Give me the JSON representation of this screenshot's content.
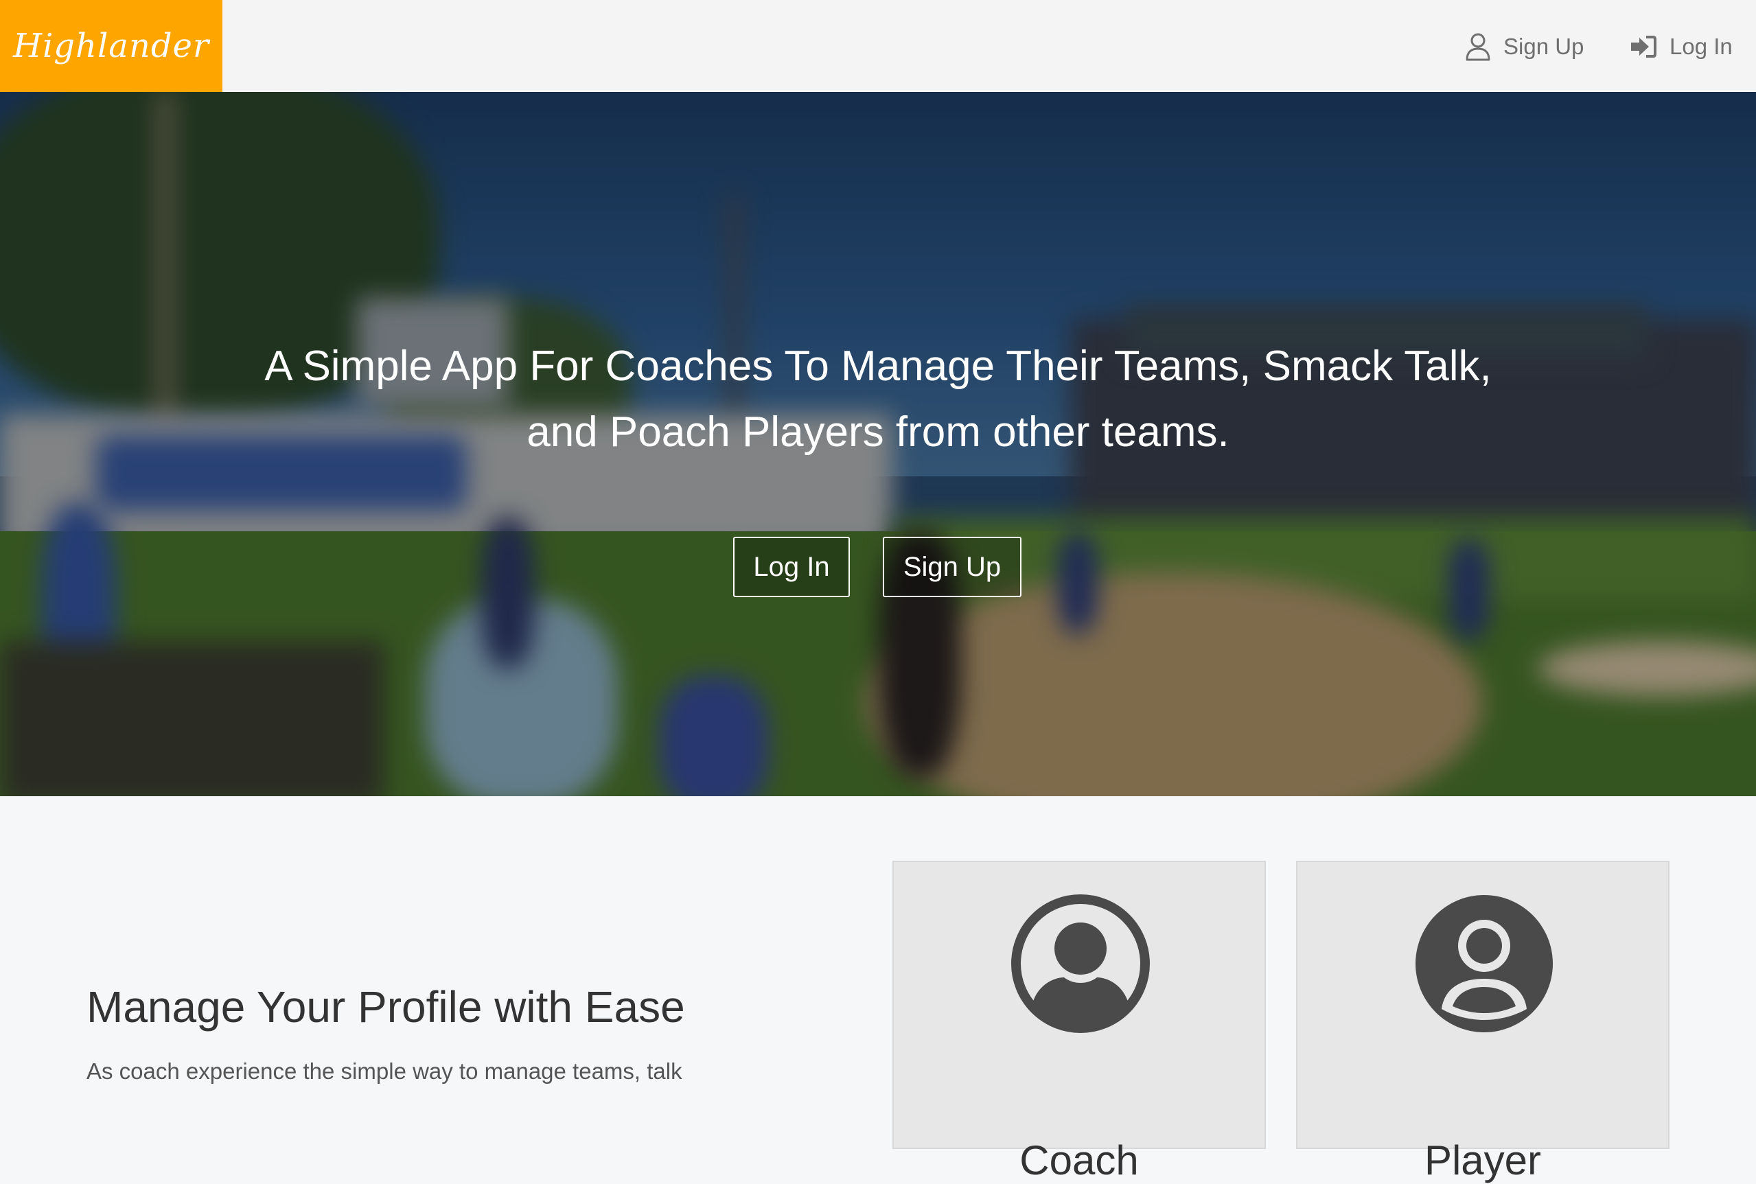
{
  "navbar": {
    "brand": "Highlander",
    "signup_label": "Sign Up",
    "login_label": "Log In",
    "brand_color": "#ffa500"
  },
  "hero": {
    "title_line1": "A Simple App For Coaches To Manage Their Teams, Smack Talk,",
    "title_line2": "and Poach Players from other teams.",
    "login_button": "Log In",
    "signup_button": "Sign Up"
  },
  "features": {
    "title": "Manage Your Profile with Ease",
    "text": "As coach experience the simple way to manage teams, talk",
    "cards": [
      {
        "label": "Coach",
        "icon": "user-circle-outline-icon"
      },
      {
        "label": "Player",
        "icon": "user-circle-solid-icon"
      }
    ]
  }
}
